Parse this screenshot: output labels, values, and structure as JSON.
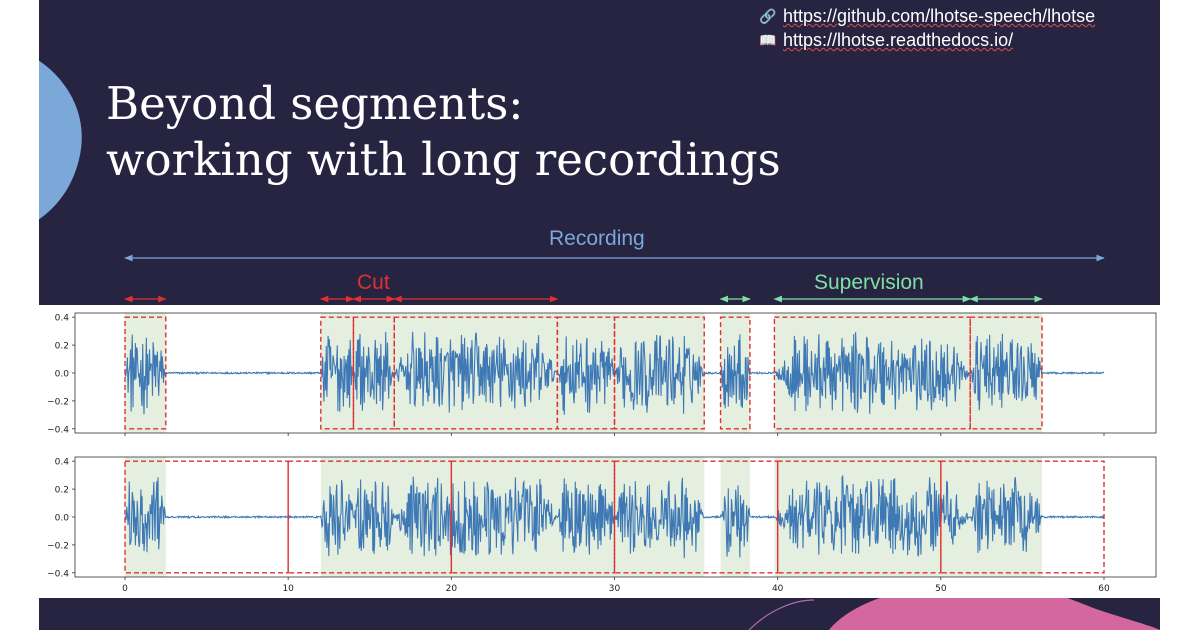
{
  "header": {
    "links": [
      {
        "icon": "link-icon",
        "glyph": "🔗",
        "text": "https://github.com/lhotse-speech/lhotse"
      },
      {
        "icon": "book-icon",
        "glyph": "📖",
        "text": "https://lhotse.readthedocs.io/"
      }
    ]
  },
  "slide": {
    "title_line1": "Beyond segments:",
    "title_line2": "working with long recordings"
  },
  "diagram": {
    "recording_label": "Recording",
    "cut_label": "Cut",
    "supervision_label": "Supervision",
    "colors": {
      "recording": "#7ba7d9",
      "cut": "#e03030",
      "supervision": "#7fe0a6",
      "waveform": "#3e79b5",
      "shade": "#e4efe0",
      "background": "#262440",
      "blob_blue": "#7ba7d9",
      "blob_pink": "#d4679e"
    }
  },
  "chart_data": {
    "type": "line",
    "title": "",
    "xlabel": "",
    "ylabel": "",
    "xlim": [
      0,
      60
    ],
    "ylim": [
      -0.43,
      0.43
    ],
    "xticks": [
      "0",
      "10",
      "20",
      "30",
      "40",
      "50",
      "60"
    ],
    "yticks": [
      "0.4",
      "0.2",
      "0.0",
      "−0.2",
      "−0.4"
    ],
    "supervisions": [
      [
        0,
        2.5
      ],
      [
        12,
        14
      ],
      [
        14,
        16.5
      ],
      [
        16.5,
        26.5
      ],
      [
        26.5,
        30
      ],
      [
        30,
        35.5
      ],
      [
        36.5,
        38.3
      ],
      [
        39.8,
        51.8
      ],
      [
        51.8,
        56.2
      ]
    ],
    "top_panel_cuts": [
      [
        0,
        2.5
      ],
      [
        12,
        14
      ],
      [
        14,
        16.5
      ],
      [
        16.5,
        26.5
      ],
      [
        26.5,
        30
      ],
      [
        30,
        35.5
      ],
      [
        36.5,
        38.3
      ],
      [
        39.8,
        51.8
      ],
      [
        51.8,
        56.2
      ]
    ],
    "bottom_panel_cuts": [
      [
        0,
        10
      ],
      [
        10,
        20
      ],
      [
        20,
        30
      ],
      [
        30,
        40
      ],
      [
        40,
        50
      ],
      [
        50,
        60
      ]
    ]
  }
}
